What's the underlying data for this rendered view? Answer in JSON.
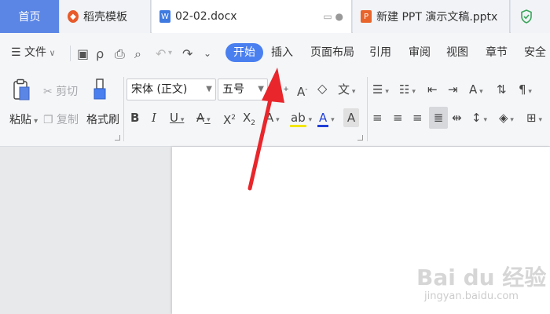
{
  "tabs": {
    "home": "首页",
    "template": "稻壳模板",
    "doc": "02-02.docx",
    "ppt": "新建 PPT 演示文稿.pptx"
  },
  "menu": {
    "file": "文件",
    "start": "开始",
    "insert": "插入",
    "layout": "页面布局",
    "reference": "引用",
    "review": "审阅",
    "view": "视图",
    "section": "章节",
    "security": "安全"
  },
  "clipboard": {
    "paste": "粘贴",
    "cut": "剪切",
    "copy": "复制",
    "format_painter": "格式刷"
  },
  "font": {
    "name": "宋体 (正文)",
    "size": "五号"
  },
  "watermark": {
    "logo": "Bai du 经验",
    "url": "jingyan.baidu.com"
  },
  "colors": {
    "accent": "#4a7ff0",
    "home_tab": "#5b86e5",
    "arrow": "#e8262b",
    "highlight": "#f2e600",
    "font_color": "#1f3fd6"
  }
}
